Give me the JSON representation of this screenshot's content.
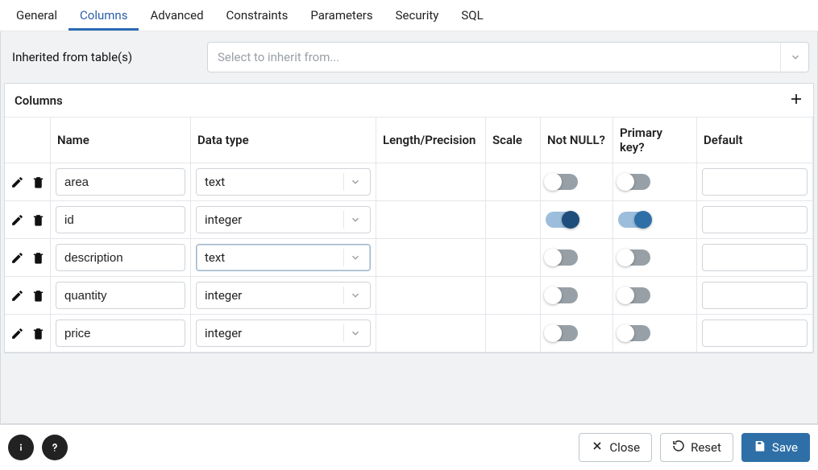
{
  "tabs": {
    "items": [
      "General",
      "Columns",
      "Advanced",
      "Constraints",
      "Parameters",
      "Security",
      "SQL"
    ],
    "active_index": 1
  },
  "inherit": {
    "label": "Inherited from table(s)",
    "placeholder": "Select to inherit from..."
  },
  "panel": {
    "title": "Columns",
    "headers": {
      "name": "Name",
      "type": "Data type",
      "len": "Length/Precision",
      "scale": "Scale",
      "nn": "Not NULL?",
      "pk": "Primary key?",
      "def": "Default"
    }
  },
  "rows": [
    {
      "name": "area",
      "type": "text",
      "len": "",
      "scale": "",
      "nn": false,
      "pk": false,
      "def": "",
      "type_focused": false
    },
    {
      "name": "id",
      "type": "integer",
      "len": "",
      "scale": "",
      "nn": true,
      "pk": true,
      "def": "",
      "type_focused": false
    },
    {
      "name": "description",
      "type": "text",
      "len": "",
      "scale": "",
      "nn": false,
      "pk": false,
      "def": "",
      "type_focused": true
    },
    {
      "name": "quantity",
      "type": "integer",
      "len": "",
      "scale": "",
      "nn": false,
      "pk": false,
      "def": "",
      "type_focused": false
    },
    {
      "name": "price",
      "type": "integer",
      "len": "",
      "scale": "",
      "nn": false,
      "pk": false,
      "def": "",
      "type_focused": false
    }
  ],
  "footer": {
    "close": "Close",
    "reset": "Reset",
    "save": "Save"
  }
}
